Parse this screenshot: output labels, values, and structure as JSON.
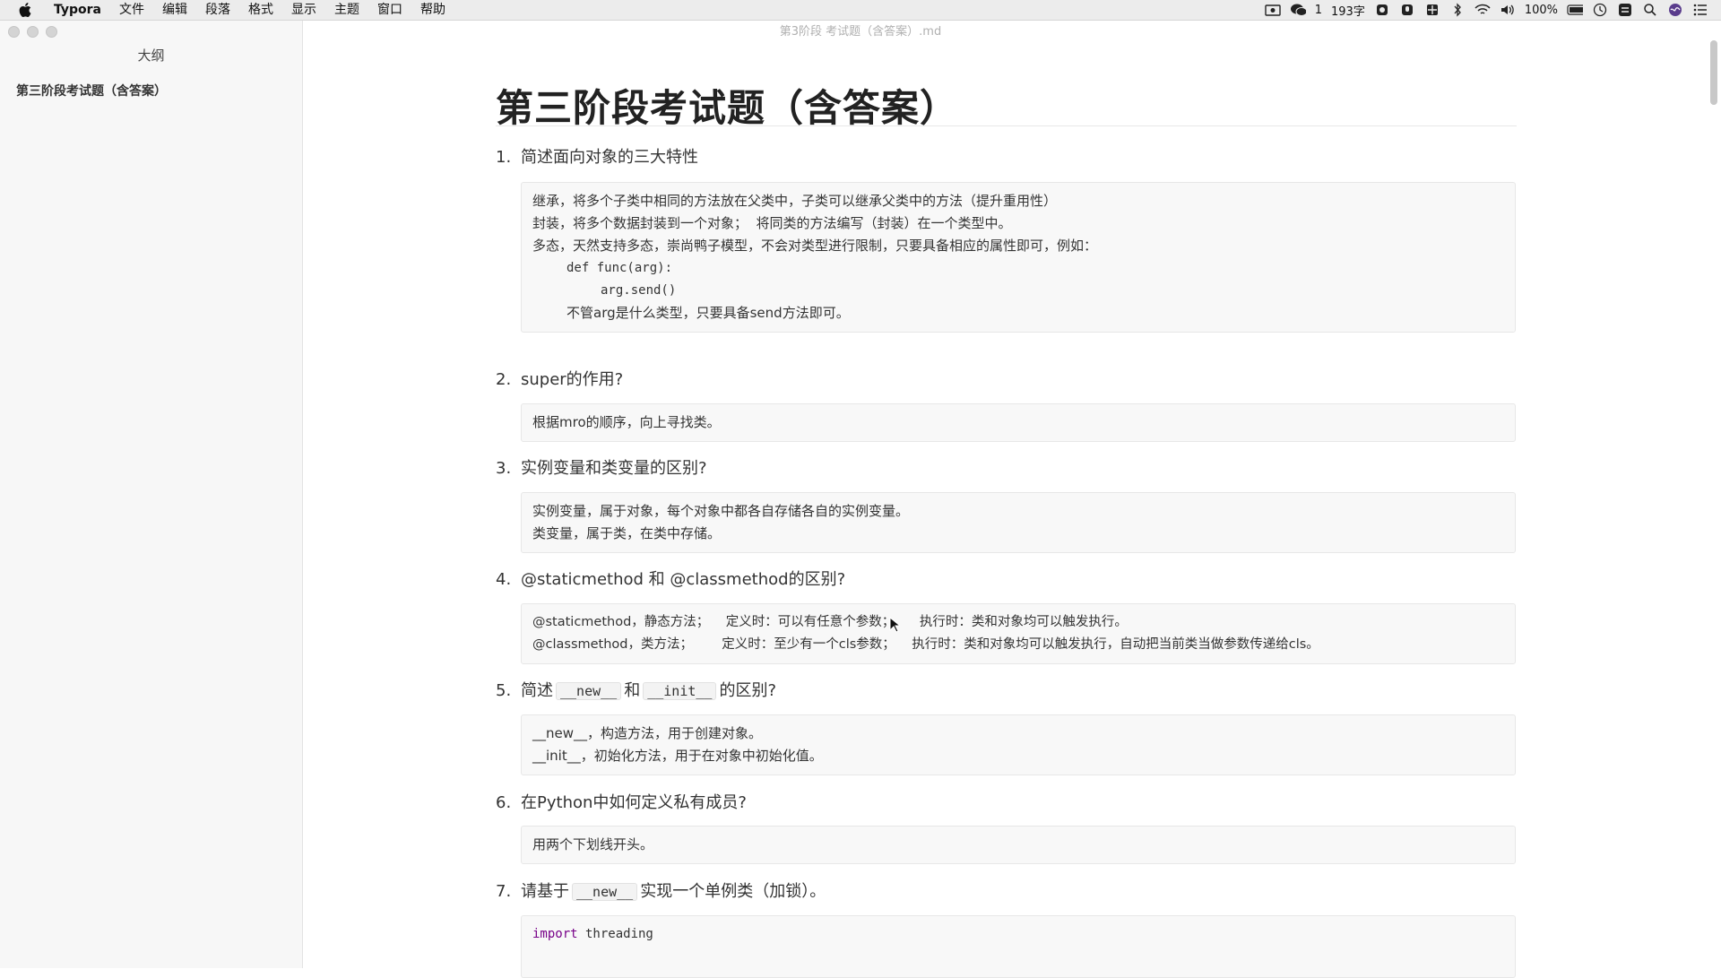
{
  "menubar": {
    "app_name": "Typora",
    "menus": [
      "文件",
      "编辑",
      "段落",
      "格式",
      "显示",
      "主题",
      "窗口",
      "帮助"
    ],
    "wechat_count": "1",
    "word_count": "193字",
    "battery": "100%"
  },
  "window": {
    "doc_title": "第3阶段 考试题（含答案）.md"
  },
  "sidebar": {
    "header": "大纲",
    "outline_item": "第三阶段考试题（含答案）"
  },
  "document": {
    "title": "第三阶段考试题（含答案）",
    "questions": [
      {
        "num": "1.",
        "text": "简述面向对象的三大特性",
        "answer": [
          "继承，将多个子类中相同的方法放在父类中，子类可以继承父类中的方法（提升重用性）",
          "封装，将多个数据封装到一个对象；  将同类的方法编写（封装）在一个类型中。",
          "多态，天然支持多态，崇尚鸭子模型，不会对类型进行限制，只要具备相应的属性即可，例如：",
          "def func(arg):",
          "arg.send()",
          "不管arg是什么类型，只要具备send方法即可。"
        ]
      },
      {
        "num": "2.",
        "text": "super的作用?",
        "answer": [
          "根据mro的顺序，向上寻找类。"
        ]
      },
      {
        "num": "3.",
        "text": "实例变量和类变量的区别?",
        "answer": [
          "实例变量，属于对象，每个对象中都各自存储各自的实例变量。",
          "类变量，属于类，在类中存储。"
        ]
      },
      {
        "num": "4.",
        "text": "@staticmethod 和 @classmethod的区别?",
        "answer": [
          "@staticmethod，静态方法；    定义时：可以有任意个参数；      执行时：类和对象均可以触发执行。",
          "@classmethod，类方法；       定义时：至少有一个cls参数；    执行时：类和对象均可以触发执行，自动把当前类当做参数传递给cls。"
        ]
      },
      {
        "num": "5.",
        "text_pre": "简述",
        "code1": "__new__",
        "text_mid": "和",
        "code2": "__init__",
        "text_post": "的区别?",
        "answer": [
          "__new__，构造方法，用于创建对象。",
          "__init__，初始化方法，用于在对象中初始化值。"
        ]
      },
      {
        "num": "6.",
        "text": "在Python中如何定义私有成员?",
        "answer": [
          "用两个下划线开头。"
        ]
      },
      {
        "num": "7.",
        "text_pre": "请基于",
        "code1": "__new__",
        "text_post": "实现一个单例类（加锁）。",
        "code_keyword": "import",
        "code_rest": " threading"
      }
    ]
  }
}
